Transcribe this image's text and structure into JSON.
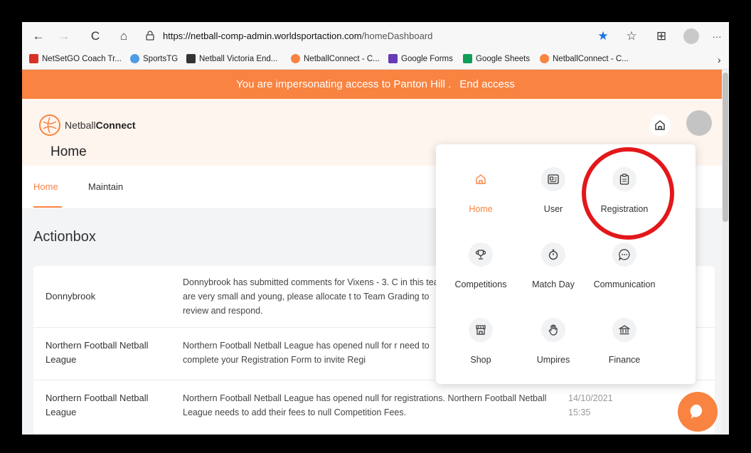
{
  "browser": {
    "url_domain": "https://netball-comp-admin.worldsportaction.com",
    "url_path": "/homeDashboard",
    "back": "←",
    "forward": "→",
    "refresh": "C",
    "home": "⌂",
    "lock": "🔒",
    "star": "★",
    "favorites": "☆",
    "collections": "⊞",
    "more": "···"
  },
  "bookmarks": [
    {
      "label": "NetSetGO Coach Tr...",
      "color": "#d93025"
    },
    {
      "label": "SportsTG",
      "color": "#4e9be6"
    },
    {
      "label": "Netball Victoria End...",
      "color": "#333333"
    },
    {
      "label": "NetballConnect - C...",
      "color": "#f98340"
    },
    {
      "label": "Google Forms",
      "color": "#673ab7"
    },
    {
      "label": "Google Sheets",
      "color": "#0f9d58"
    },
    {
      "label": "NetballConnect - C...",
      "color": "#f98340"
    }
  ],
  "banner": {
    "message": "You are impersonating access to Panton Hill .",
    "end_label": "End access"
  },
  "header": {
    "logo_prefix": "Netball",
    "logo_bold": "Connect",
    "page_title": "Home"
  },
  "tabs": [
    "Home",
    "Maintain"
  ],
  "actionbox": {
    "title": "Actionbox",
    "rows": [
      {
        "org": "Donnybrook",
        "message": "Donnybrook has submitted comments for Vixens - 3. C in this team are very small and young, please allocate t to Team Grading to review and respond.",
        "date": ""
      },
      {
        "org": "Northern Football Netball League",
        "message": "Northern Football Netball League has opened null for r need to complete your Registration Form to invite Regi",
        "date": ""
      },
      {
        "org": "Northern Football Netball League",
        "message": "Northern Football Netball League has opened null for registrations. Northern Football Netball League needs to add their fees to null Competition Fees.",
        "date": "14/10/2021 15:35"
      }
    ]
  },
  "menu": [
    {
      "label": "Home",
      "icon": "home-icon",
      "glyph": "⌂"
    },
    {
      "label": "User",
      "icon": "user-card-icon",
      "glyph": "▤"
    },
    {
      "label": "Registration",
      "icon": "clipboard-icon",
      "glyph": "📋"
    },
    {
      "label": "Competitions",
      "icon": "trophy-icon",
      "glyph": "🏆"
    },
    {
      "label": "Match Day",
      "icon": "stopwatch-icon",
      "glyph": "⏱"
    },
    {
      "label": "Communication",
      "icon": "chat-icon",
      "glyph": "💬"
    },
    {
      "label": "Shop",
      "icon": "shop-icon",
      "glyph": "🏪"
    },
    {
      "label": "Umpires",
      "icon": "hand-icon",
      "glyph": "✋"
    },
    {
      "label": "Finance",
      "icon": "bank-icon",
      "glyph": "🏛"
    }
  ],
  "colors": {
    "accent": "#f98340",
    "highlight_circle": "#e3171a"
  }
}
